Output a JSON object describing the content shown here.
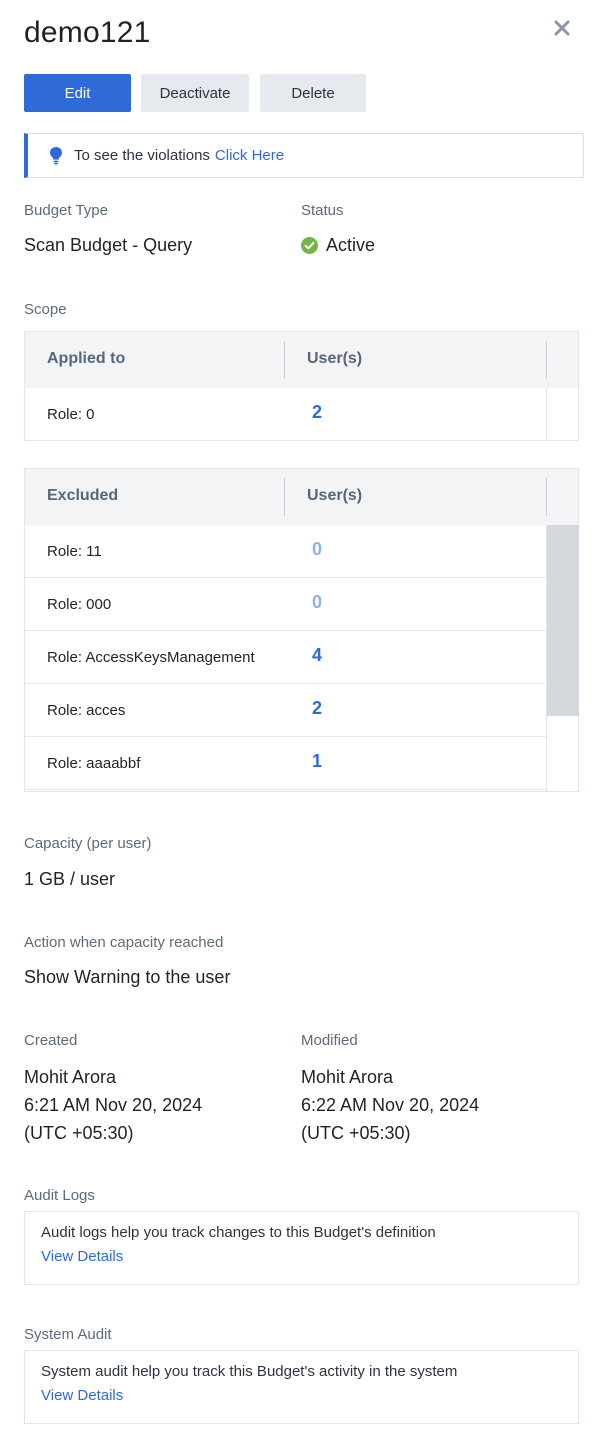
{
  "header": {
    "title": "demo121",
    "close_icon": "close-icon"
  },
  "actions": {
    "edit": "Edit",
    "deactivate": "Deactivate",
    "delete": "Delete"
  },
  "info_banner": {
    "icon": "lightbulb-icon",
    "text": "To see the violations",
    "link": "Click Here"
  },
  "budget_type": {
    "label": "Budget Type",
    "value": "Scan Budget - Query"
  },
  "status": {
    "label": "Status",
    "value": "Active",
    "color": "#74b54a"
  },
  "scope": {
    "label": "Scope",
    "applied": {
      "headers": [
        "Applied to",
        "User(s)"
      ],
      "rows": [
        {
          "name": "Role: 0",
          "users": "2"
        }
      ]
    },
    "excluded": {
      "headers": [
        "Excluded",
        "User(s)"
      ],
      "rows": [
        {
          "name": "Role: 11",
          "users": "0"
        },
        {
          "name": "Role: 000",
          "users": "0"
        },
        {
          "name": "Role: AccessKeysManagement",
          "users": "4"
        },
        {
          "name": "Role: acces",
          "users": "2"
        },
        {
          "name": "Role: aaaabbf",
          "users": "1"
        }
      ]
    }
  },
  "capacity": {
    "label": "Capacity (per user)",
    "value": "1 GB / user"
  },
  "action_on_capacity": {
    "label": "Action when capacity reached",
    "value": "Show Warning to the user"
  },
  "created": {
    "label": "Created",
    "by": "Mohit Arora",
    "time": "6:21 AM Nov 20, 2024",
    "tz": "(UTC +05:30)"
  },
  "modified": {
    "label": "Modified",
    "by": "Mohit Arora",
    "time": "6:22 AM Nov 20, 2024",
    "tz": "(UTC +05:30)"
  },
  "audit_logs": {
    "label": "Audit Logs",
    "text": "Audit logs help you track changes to this Budget's definition",
    "link": "View Details"
  },
  "system_audit": {
    "label": "System Audit",
    "text": "System audit help you track this Budget's activity in the system",
    "link": "View Details"
  },
  "colors": {
    "accent": "#2e6ad8",
    "secondary_button": "#e6e9ee",
    "label_text": "#5d6b7a"
  }
}
